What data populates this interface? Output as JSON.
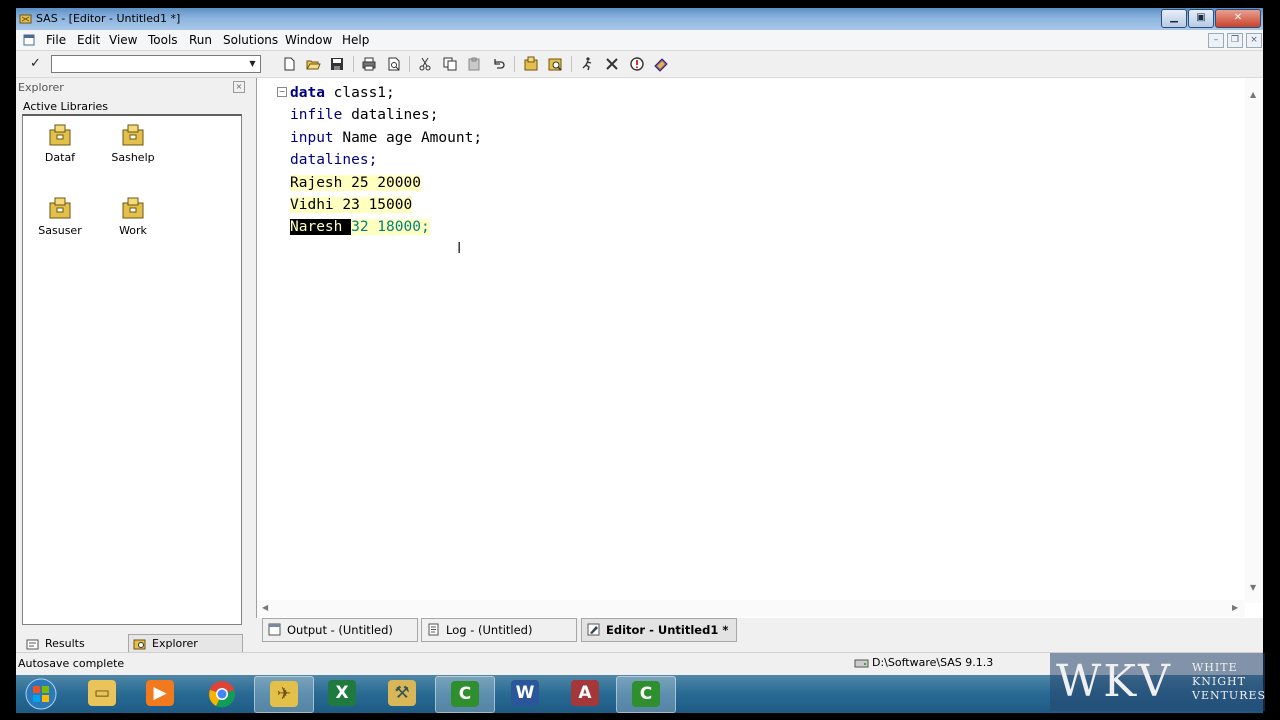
{
  "window": {
    "title": "SAS - [Editor - Untitled1 *]"
  },
  "menu": [
    "File",
    "Edit",
    "View",
    "Tools",
    "Run",
    "Solutions",
    "Window",
    "Help"
  ],
  "toolbar": {
    "command_value": "",
    "icons": [
      "new-icon",
      "open-icon",
      "save-icon",
      "print-icon",
      "print-preview-icon",
      "cut-icon",
      "copy-icon",
      "paste-icon",
      "undo-icon",
      "libraries-icon",
      "explorer-view-icon",
      "submit-icon",
      "clear-icon",
      "break-icon",
      "help-icon"
    ]
  },
  "explorer": {
    "title": "Explorer",
    "label": "Active Libraries",
    "libraries": [
      {
        "name": "Dataf"
      },
      {
        "name": "Sashelp"
      },
      {
        "name": "Sasuser"
      },
      {
        "name": "Work"
      }
    ],
    "tabs": {
      "results": "Results",
      "explorer": "Explorer"
    }
  },
  "editor": {
    "line1_kw": "data",
    "line1_rest": " class1;",
    "line2_kw": "infile",
    "line2_rest": " datalines;",
    "line3_kw": "input",
    "line3_rest": " Name age Amount;",
    "line4_kw": "datalines;",
    "line5": "Rajesh 25 20000",
    "line6": "Vidhi 23 15000",
    "line7_selected": "Naresh ",
    "line7_rest": "32 18000;"
  },
  "window_tabs": {
    "output": "Output - (Untitled)",
    "log": "Log - (Untitled)",
    "editor": "Editor - Untitled1 *"
  },
  "status": {
    "text": "Autosave complete",
    "path": "D:\\Software\\SAS 9.1.3"
  },
  "logo": {
    "mark": "WKV",
    "line1": "WHITE",
    "line2": "KNIGHT",
    "line3": "VENTURES"
  },
  "colors": {
    "keyword": "#000080",
    "datalines_bg": "#ffffc0",
    "taskbar": "#286a94"
  }
}
